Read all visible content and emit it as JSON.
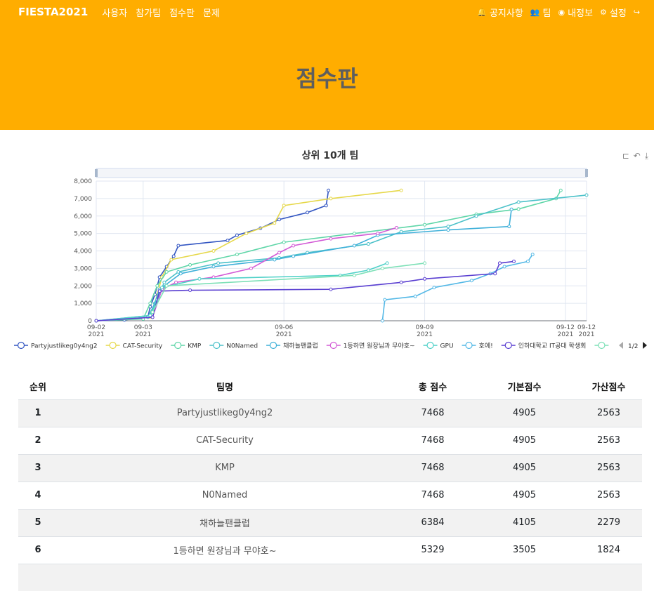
{
  "nav": {
    "brand": "FIESTA2021",
    "left": [
      "사용자",
      "참가팀",
      "점수판",
      "문제"
    ],
    "right": [
      {
        "icon": "bell-icon",
        "glyph": "🔔",
        "label": "공지사항"
      },
      {
        "icon": "users-icon",
        "glyph": "👥",
        "label": "팀"
      },
      {
        "icon": "user-circle-icon",
        "glyph": "◉",
        "label": "내정보"
      },
      {
        "icon": "cogs-icon",
        "glyph": "⚙",
        "label": "설정"
      },
      {
        "icon": "sign-out-icon",
        "glyph": "↪",
        "label": ""
      }
    ]
  },
  "page_title": "점수판",
  "toolbox": [
    "zoom-icon",
    "zoom-reset-icon",
    "download-icon"
  ],
  "chart_data": {
    "type": "line",
    "title": "상위 10개 팀",
    "ylim": [
      0,
      8000
    ],
    "yticks": [
      "0",
      "1,000",
      "2,000",
      "3,000",
      "4,000",
      "5,000",
      "6,000",
      "7,000",
      "8,000"
    ],
    "xlim": [
      "2021-09-02",
      "2021-09-12 12:00"
    ],
    "xticks": [
      {
        "t": 0,
        "l1": "09-02",
        "l2": "2021"
      },
      {
        "t": 1,
        "l1": "09-03",
        "l2": "2021"
      },
      {
        "t": 4,
        "l1": "09-06",
        "l2": "2021"
      },
      {
        "t": 7,
        "l1": "09-09",
        "l2": "2021"
      },
      {
        "t": 10,
        "l1": "09-12",
        "l2": "2021"
      },
      {
        "t": 10.45,
        "l1": "09-12",
        "l2": "2021"
      }
    ],
    "legend_page": "1/2",
    "series": [
      {
        "name": "Partyjustlikeg0y4ng2",
        "color": "#3356c2",
        "points": [
          [
            0,
            0
          ],
          [
            0.6,
            50
          ],
          [
            1.1,
            200
          ],
          [
            1.15,
            800
          ],
          [
            1.25,
            1500
          ],
          [
            1.35,
            2500
          ],
          [
            1.5,
            3100
          ],
          [
            1.65,
            3700
          ],
          [
            1.75,
            4300
          ],
          [
            2.8,
            4600
          ],
          [
            3,
            4900
          ],
          [
            3.5,
            5300
          ],
          [
            3.9,
            5800
          ],
          [
            4.5,
            6200
          ],
          [
            4.9,
            6600
          ],
          [
            4.95,
            7468
          ]
        ]
      },
      {
        "name": "CAT-Security",
        "color": "#e6d84a",
        "points": [
          [
            0,
            0
          ],
          [
            1.15,
            200
          ],
          [
            1.25,
            1000
          ],
          [
            1.4,
            2500
          ],
          [
            1.6,
            3500
          ],
          [
            2.5,
            4000
          ],
          [
            3.2,
            5000
          ],
          [
            3.8,
            5600
          ],
          [
            4,
            6600
          ],
          [
            5,
            7000
          ],
          [
            6.5,
            7468
          ]
        ]
      },
      {
        "name": "KMP",
        "color": "#5fd6a8",
        "points": [
          [
            0,
            0
          ],
          [
            1,
            100
          ],
          [
            1.15,
            1000
          ],
          [
            1.3,
            2000
          ],
          [
            1.5,
            2800
          ],
          [
            2,
            3200
          ],
          [
            3,
            3800
          ],
          [
            4,
            4500
          ],
          [
            5.5,
            5000
          ],
          [
            7,
            5500
          ],
          [
            8.1,
            6100
          ],
          [
            9,
            6400
          ],
          [
            9.8,
            7000
          ],
          [
            9.9,
            7468
          ]
        ]
      },
      {
        "name": "N0Named",
        "color": "#4bc1c9",
        "points": [
          [
            0,
            0
          ],
          [
            1.1,
            200
          ],
          [
            1.25,
            1000
          ],
          [
            1.45,
            2200
          ],
          [
            1.75,
            2800
          ],
          [
            2.6,
            3300
          ],
          [
            3.9,
            3600
          ],
          [
            4.5,
            3900
          ],
          [
            5.8,
            4400
          ],
          [
            6.5,
            5100
          ],
          [
            7.5,
            5400
          ],
          [
            8.1,
            6000
          ],
          [
            9,
            6800
          ],
          [
            10.45,
            7200
          ]
        ]
      },
      {
        "name": "채하늘팬클럽",
        "color": "#3fb0d9",
        "points": [
          [
            0,
            0
          ],
          [
            1.15,
            300
          ],
          [
            1.35,
            1800
          ],
          [
            1.8,
            2700
          ],
          [
            2.5,
            3100
          ],
          [
            3.8,
            3500
          ],
          [
            4.2,
            3700
          ],
          [
            5.5,
            4300
          ],
          [
            6,
            4900
          ],
          [
            7.5,
            5200
          ],
          [
            8.8,
            5400
          ],
          [
            8.85,
            6384
          ]
        ]
      },
      {
        "name": "1등하면 원장님과 무야호~",
        "color": "#d35bd6",
        "points": [
          [
            0,
            0
          ],
          [
            1.2,
            200
          ],
          [
            1.4,
            1800
          ],
          [
            1.7,
            2200
          ],
          [
            2.5,
            2500
          ],
          [
            3.3,
            3000
          ],
          [
            3.9,
            3900
          ],
          [
            4.2,
            4300
          ],
          [
            5,
            4700
          ],
          [
            6,
            5000
          ],
          [
            6.4,
            5329
          ]
        ]
      },
      {
        "name": "GPU",
        "color": "#4fd1c8",
        "points": [
          [
            0,
            0
          ],
          [
            1.15,
            300
          ],
          [
            1.3,
            1200
          ],
          [
            1.4,
            1900
          ],
          [
            2.2,
            2400
          ],
          [
            5.2,
            2600
          ],
          [
            5.8,
            2900
          ],
          [
            6.2,
            3300
          ]
        ]
      },
      {
        "name": "호에!",
        "color": "#53b8e6",
        "points": [
          [
            6.1,
            0
          ],
          [
            6.15,
            1200
          ],
          [
            6.8,
            1400
          ],
          [
            7.2,
            1900
          ],
          [
            8,
            2300
          ],
          [
            8.4,
            2700
          ],
          [
            8.7,
            3100
          ],
          [
            9.2,
            3400
          ],
          [
            9.3,
            3800
          ]
        ]
      },
      {
        "name": "인하대학교 IT공대 학생회",
        "color": "#5a3fd1",
        "points": [
          [
            0,
            0
          ],
          [
            1.2,
            200
          ],
          [
            1.35,
            1700
          ],
          [
            2,
            1750
          ],
          [
            5,
            1800
          ],
          [
            6.5,
            2200
          ],
          [
            7,
            2400
          ],
          [
            8.5,
            2700
          ],
          [
            8.6,
            3300
          ],
          [
            8.9,
            3400
          ]
        ]
      },
      {
        "name": "",
        "color": "#7de0b7",
        "points": [
          [
            1.2,
            500
          ],
          [
            1.5,
            2000
          ],
          [
            5.5,
            2600
          ],
          [
            6.1,
            3000
          ],
          [
            7,
            3300
          ]
        ]
      }
    ]
  },
  "table": {
    "headers": [
      "순위",
      "팀명",
      "총 점수",
      "기본점수",
      "가산점수"
    ],
    "rows": [
      [
        "1",
        "Partyjustlikeg0y4ng2",
        "7468",
        "4905",
        "2563"
      ],
      [
        "2",
        "CAT-Security",
        "7468",
        "4905",
        "2563"
      ],
      [
        "3",
        "KMP",
        "7468",
        "4905",
        "2563"
      ],
      [
        "4",
        "N0Named",
        "7468",
        "4905",
        "2563"
      ],
      [
        "5",
        "채하늘팬클럽",
        "6384",
        "4105",
        "2279"
      ],
      [
        "6",
        "1등하면 원장님과 무야호~",
        "5329",
        "3505",
        "1824"
      ],
      [
        "",
        "",
        "",
        "",
        ""
      ]
    ]
  }
}
